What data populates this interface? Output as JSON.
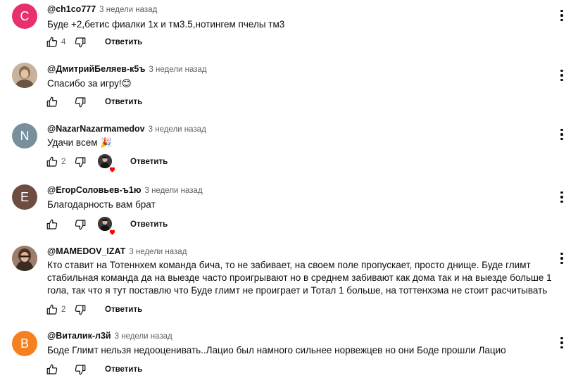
{
  "comments": [
    {
      "author": "@ch1co777",
      "time": "3 недели назад",
      "avatar_letter": "C",
      "avatar_color": "#e8306e",
      "text": "Буде +2,бетис фиалки 1х и тм3.5,нотингем пчелы тм3",
      "likes": "4",
      "reply_label": "Ответить",
      "heart": false
    },
    {
      "author": "@ДмитрийБеляев-к5ъ",
      "time": "3 недели назад",
      "avatar_letter": "",
      "avatar_color": "#b9a48f",
      "text": "Спасибо за игру!😊",
      "likes": "",
      "reply_label": "Ответить",
      "heart": false
    },
    {
      "author": "@NazarNazarmamedov",
      "time": "3 недели назад",
      "avatar_letter": "N",
      "avatar_color": "#78909c",
      "text": "Удачи всем 🎉",
      "likes": "2",
      "reply_label": "Ответить",
      "heart": true
    },
    {
      "author": "@ЕгорСоловьев-ъ1ю",
      "time": "3 недели назад",
      "avatar_letter": "E",
      "avatar_color": "#6d4c41",
      "text": "Благодарность вам брат",
      "likes": "",
      "reply_label": "Ответить",
      "heart": true
    },
    {
      "author": "@MAMEDOV_IZAT",
      "time": "3 недели назад",
      "avatar_letter": "",
      "avatar_color": "#a98b7a",
      "text": "Кто ставит на Тотеннхем команда бича, то не забивает, на своем поле пропускает, просто днище. Буде глимт стабильная команда да на выезде часто проигрывают но в среднем забивают как дома так и на выезде больше 1 гола, так что я тут поставлю что Буде глимт не проиграет и Тотал 1 больше, на тоттенхэма не стоит расчитывать",
      "likes": "2",
      "reply_label": "Ответить",
      "heart": false
    },
    {
      "author": "@Виталик-л3й",
      "time": "3 недели назад",
      "avatar_letter": "B",
      "avatar_color": "#f4801f",
      "text": "Боде Глимт нельзя недооценивать..Лацио был намного сильнее норвежцев но они Боде прошли Лацио",
      "likes": "",
      "reply_label": "Ответить",
      "heart": false
    }
  ],
  "colors": {
    "text": "#0f0f0f",
    "meta": "#606060",
    "heart": "#ff0000"
  }
}
